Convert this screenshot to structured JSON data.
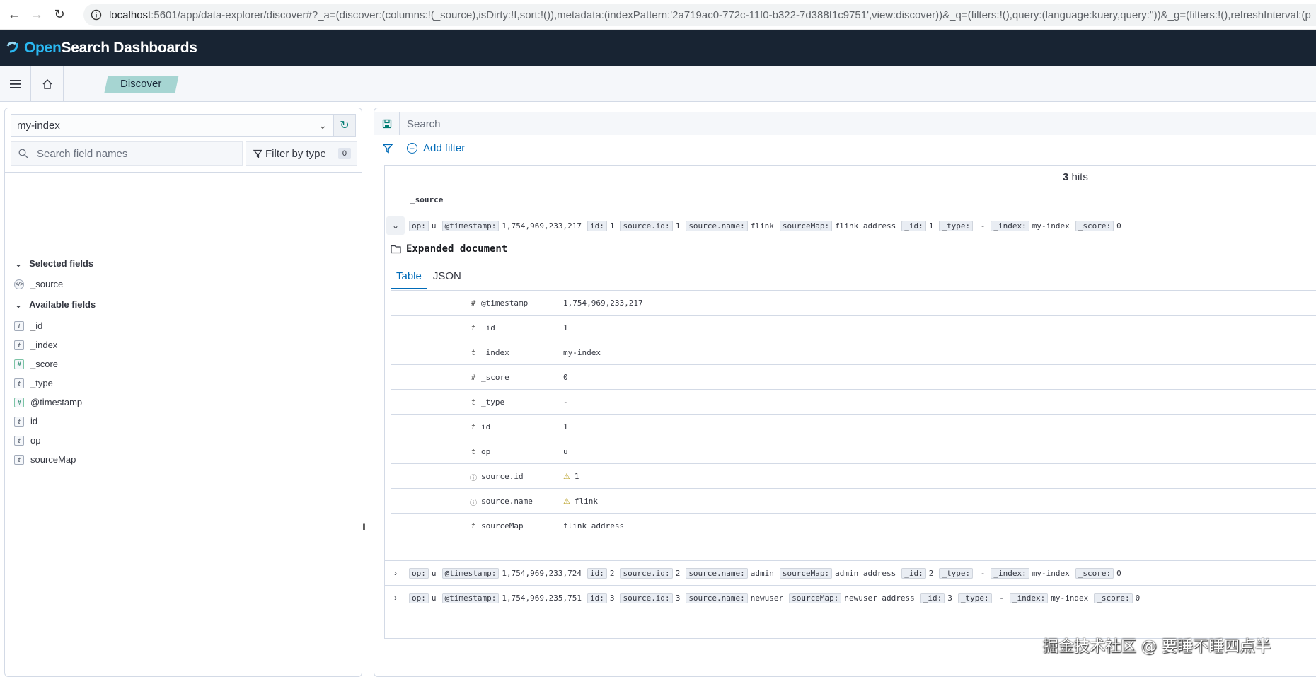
{
  "browser": {
    "url_host": "localhost",
    "url_rest": ":5601/app/data-explorer/discover#?_a=(discover:(columns:!(_source),isDirty:!f,sort:!()),metadata:(indexPattern:'2a719ac0-772c-11f0-b322-7d388f1c9751',view:discover))&_q=(filters:!(),query:(language:kuery,query:''))&_g=(filters:!(),refreshInterval:(p"
  },
  "header": {
    "logo_open": "Open",
    "logo_search": "Search",
    "logo_rest": " Dashboards"
  },
  "nav": {
    "breadcrumb": "Discover"
  },
  "sidebar": {
    "index_pattern": "my-index",
    "search_placeholder": "Search field names",
    "filter_type_label": "Filter by type",
    "filter_type_count": "0",
    "selected_title": "Selected fields",
    "available_title": "Available fields",
    "selected_fields": [
      {
        "name": "_source",
        "type": "source"
      }
    ],
    "available_fields": [
      {
        "name": "_id",
        "type": "t"
      },
      {
        "name": "_index",
        "type": "t"
      },
      {
        "name": "_score",
        "type": "#"
      },
      {
        "name": "_type",
        "type": "t"
      },
      {
        "name": "@timestamp",
        "type": "#"
      },
      {
        "name": "id",
        "type": "t"
      },
      {
        "name": "op",
        "type": "t"
      },
      {
        "name": "sourceMap",
        "type": "t"
      }
    ]
  },
  "query": {
    "placeholder": "Search",
    "add_filter": "Add filter"
  },
  "results": {
    "hits_count": "3",
    "hits_label": " hits",
    "column": "_source",
    "expanded_title": "Expanded document",
    "tabs": [
      "Table",
      "JSON"
    ],
    "rows": [
      [
        [
          "op:",
          "u"
        ],
        [
          "@timestamp:",
          "1,754,969,233,217"
        ],
        [
          "id:",
          "1"
        ],
        [
          "source.id:",
          "1"
        ],
        [
          "source.name:",
          "flink"
        ],
        [
          "sourceMap:",
          "flink address"
        ],
        [
          "_id:",
          "1"
        ],
        [
          "_type:",
          " -"
        ],
        [
          "_index:",
          "my-index"
        ],
        [
          "_score:",
          "0"
        ]
      ],
      [
        [
          "op:",
          "u"
        ],
        [
          "@timestamp:",
          "1,754,969,233,724"
        ],
        [
          "id:",
          "2"
        ],
        [
          "source.id:",
          "2"
        ],
        [
          "source.name:",
          "admin"
        ],
        [
          "sourceMap:",
          "admin address"
        ],
        [
          "_id:",
          "2"
        ],
        [
          "_type:",
          " -"
        ],
        [
          "_index:",
          "my-index"
        ],
        [
          "_score:",
          "0"
        ]
      ],
      [
        [
          "op:",
          "u"
        ],
        [
          "@timestamp:",
          "1,754,969,235,751"
        ],
        [
          "id:",
          "3"
        ],
        [
          "source.id:",
          "3"
        ],
        [
          "source.name:",
          "newuser"
        ],
        [
          "sourceMap:",
          "newuser address"
        ],
        [
          "_id:",
          "3"
        ],
        [
          "_type:",
          " -"
        ],
        [
          "_index:",
          "my-index"
        ],
        [
          "_score:",
          "0"
        ]
      ]
    ],
    "details": [
      {
        "type": "#",
        "field": "@timestamp",
        "value": "1,754,969,233,217",
        "warn": false
      },
      {
        "type": "t",
        "field": "_id",
        "value": "1",
        "warn": false
      },
      {
        "type": "t",
        "field": "_index",
        "value": "my-index",
        "warn": false
      },
      {
        "type": "#",
        "field": "_score",
        "value": "0",
        "warn": false
      },
      {
        "type": "t",
        "field": "_type",
        "value": " -",
        "warn": false
      },
      {
        "type": "t",
        "field": "id",
        "value": "1",
        "warn": false
      },
      {
        "type": "t",
        "field": "op",
        "value": "u",
        "warn": false
      },
      {
        "type": "?",
        "field": "source.id",
        "value": "1",
        "warn": true
      },
      {
        "type": "?",
        "field": "source.name",
        "value": "flink",
        "warn": true
      },
      {
        "type": "t",
        "field": "sourceMap",
        "value": "flink address",
        "warn": false
      }
    ]
  },
  "watermark": "掘金技术社区 @ 要睡不睡四点半"
}
